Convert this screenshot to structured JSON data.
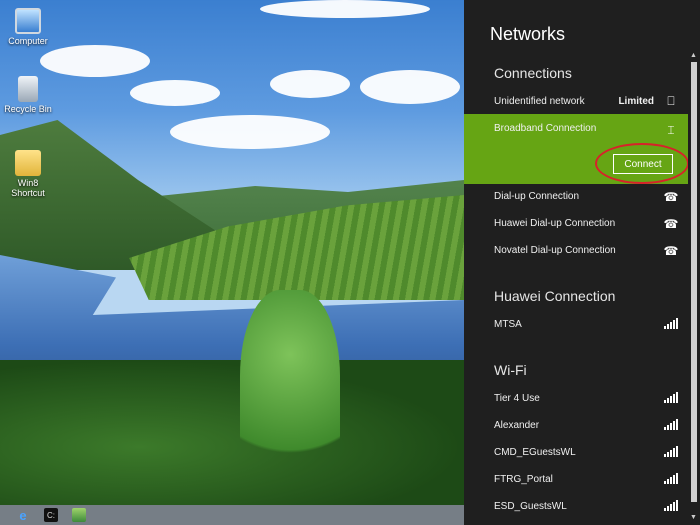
{
  "desktop": {
    "icons": [
      {
        "label": "Computer"
      },
      {
        "label": "Recycle Bin"
      },
      {
        "label": "Win8 Shortcut"
      }
    ]
  },
  "taskbar": {
    "items": [
      "internet-explorer-icon",
      "command-prompt-icon",
      "image-app-icon"
    ]
  },
  "networks_panel": {
    "title": "Networks",
    "connections": {
      "heading": "Connections",
      "items": [
        {
          "label": "Unidentified network",
          "status": "Limited",
          "icon": "wired-network-icon"
        },
        {
          "label": "Broadband Connection",
          "icon": "broadband-icon",
          "selected": true,
          "action": "Connect"
        },
        {
          "label": "Dial-up Connection",
          "icon": "phone-icon"
        },
        {
          "label": "Huawei Dial-up Connection",
          "icon": "phone-icon"
        },
        {
          "label": "Novatel Dial-up Connection",
          "icon": "phone-icon"
        }
      ]
    },
    "huawei": {
      "heading": "Huawei Connection",
      "items": [
        {
          "label": "MTSA",
          "icon": "mobile-signal-icon"
        }
      ]
    },
    "wifi": {
      "heading": "Wi-Fi",
      "items": [
        {
          "label": "Tier 4 Use",
          "icon": "wifi-signal-icon"
        },
        {
          "label": "Alexander",
          "icon": "wifi-signal-icon"
        },
        {
          "label": "CMD_EGuestsWL",
          "icon": "wifi-signal-icon"
        },
        {
          "label": "FTRG_Portal",
          "icon": "wifi-signal-icon"
        },
        {
          "label": "ESD_GuestsWL",
          "icon": "wifi-secured-signal-icon"
        }
      ]
    }
  },
  "colors": {
    "accent": "#66a514",
    "panel_bg": "#1f1f1f",
    "highlight": "#d7222a"
  }
}
